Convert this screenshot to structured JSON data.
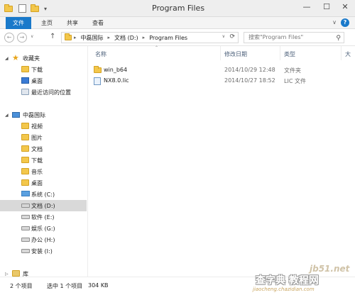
{
  "window": {
    "title": "Program Files",
    "minimize_glyph": "—",
    "maximize_glyph": "☐",
    "close_glyph": "✕"
  },
  "quick_access": {
    "dropdown_glyph": "▾"
  },
  "ribbon": {
    "tabs": [
      "文件",
      "主页",
      "共享",
      "查看"
    ],
    "collapse_glyph": "∨",
    "help_glyph": "?"
  },
  "address": {
    "back_glyph": "←",
    "forward_glyph": "→",
    "history_glyph": "∨",
    "up_glyph": "↑",
    "path": [
      "中磊国际",
      "文档 (D:)",
      "Program Files"
    ],
    "sep_glyph": "▸",
    "dropdown_glyph": "∨",
    "refresh_glyph": "⟳",
    "search_placeholder": "搜索\"Program Files\"",
    "search_glyph": "⚲"
  },
  "nav": {
    "favorites_label": "收藏夹",
    "favorites": [
      "下载",
      "桌面",
      "最近访问的位置"
    ],
    "pc_label": "中磊国际",
    "pc_items": [
      "视频",
      "图片",
      "文档",
      "下载",
      "音乐",
      "桌面"
    ],
    "drives": [
      "系统 (C:)",
      "文档 (D:)",
      "软件 (E:)",
      "娱乐 (G:)",
      "办公 (H:)",
      "安装 (I:)"
    ],
    "library_label": "库"
  },
  "columns": {
    "name": "名称",
    "modified": "修改日期",
    "type": "类型",
    "size": "大"
  },
  "files": [
    {
      "name": "win_b64",
      "modified": "2014/10/29 12:48",
      "type": "文件夹",
      "kind": "folder"
    },
    {
      "name": "NX8.0.lic",
      "modified": "2014/10/27 18:52",
      "type": "LIC 文件",
      "kind": "file"
    }
  ],
  "status": {
    "item_count": "2 个项目",
    "selection": "选中 1 个项目",
    "size": "304 KB"
  },
  "watermark": {
    "site": "jb51.net",
    "main": "查字典 教程网",
    "url": "jiaocheng.chazidian.com"
  },
  "colors": {
    "accent": "#1979ca",
    "folder": "#f3c74b",
    "selected_bg": "#d9d9d9",
    "column_header_text": "#4c607a"
  }
}
